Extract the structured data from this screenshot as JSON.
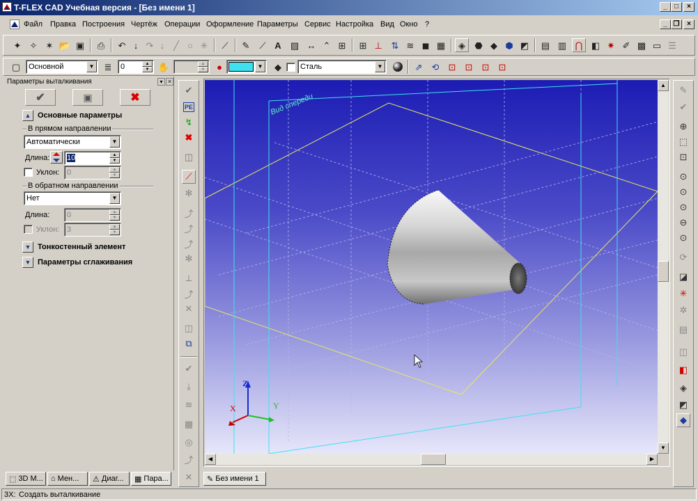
{
  "window": {
    "title": "T-FLEX CAD Учебная версия - [Без имени 1]",
    "app_icon": "tflex-app-icon"
  },
  "menu": {
    "items": [
      "Файл",
      "Правка",
      "Построения",
      "Чертёж",
      "Операции",
      "Оформление",
      "Параметры",
      "Сервис",
      "Настройка",
      "Вид",
      "Окно",
      "?"
    ]
  },
  "properties_bar": {
    "layer_value": "Основной",
    "level_value": "0",
    "material_value": "Сталь",
    "color_value": "#40e0f0"
  },
  "panel": {
    "title": "Параметры выталкивания",
    "section_main": "Основные параметры",
    "group_forward": "В прямом направлении",
    "forward_mode": "Автоматически",
    "length_label": "Длина:",
    "length_value": "10",
    "slope_label": "Уклон:",
    "slope_value": "0",
    "group_backward": "В обратном направлении",
    "backward_mode": "Нет",
    "back_length_label": "Длина:",
    "back_length_value": "0",
    "back_slope_label": "Уклон:",
    "back_slope_value": "3",
    "section_thin": "Тонкостенный элемент",
    "section_smooth": "Параметры сглаживания"
  },
  "viewport": {
    "view_label": "Вид спереди",
    "axis_x": "X",
    "axis_y": "Y",
    "axis_z": "Z"
  },
  "bottom_tabs": [
    "3D М...",
    "Мен...",
    "Диаг...",
    "Пара..."
  ],
  "document_tab": "Без имени 1",
  "status": {
    "prefix": "3Х:",
    "text": "Создать выталкивание"
  }
}
